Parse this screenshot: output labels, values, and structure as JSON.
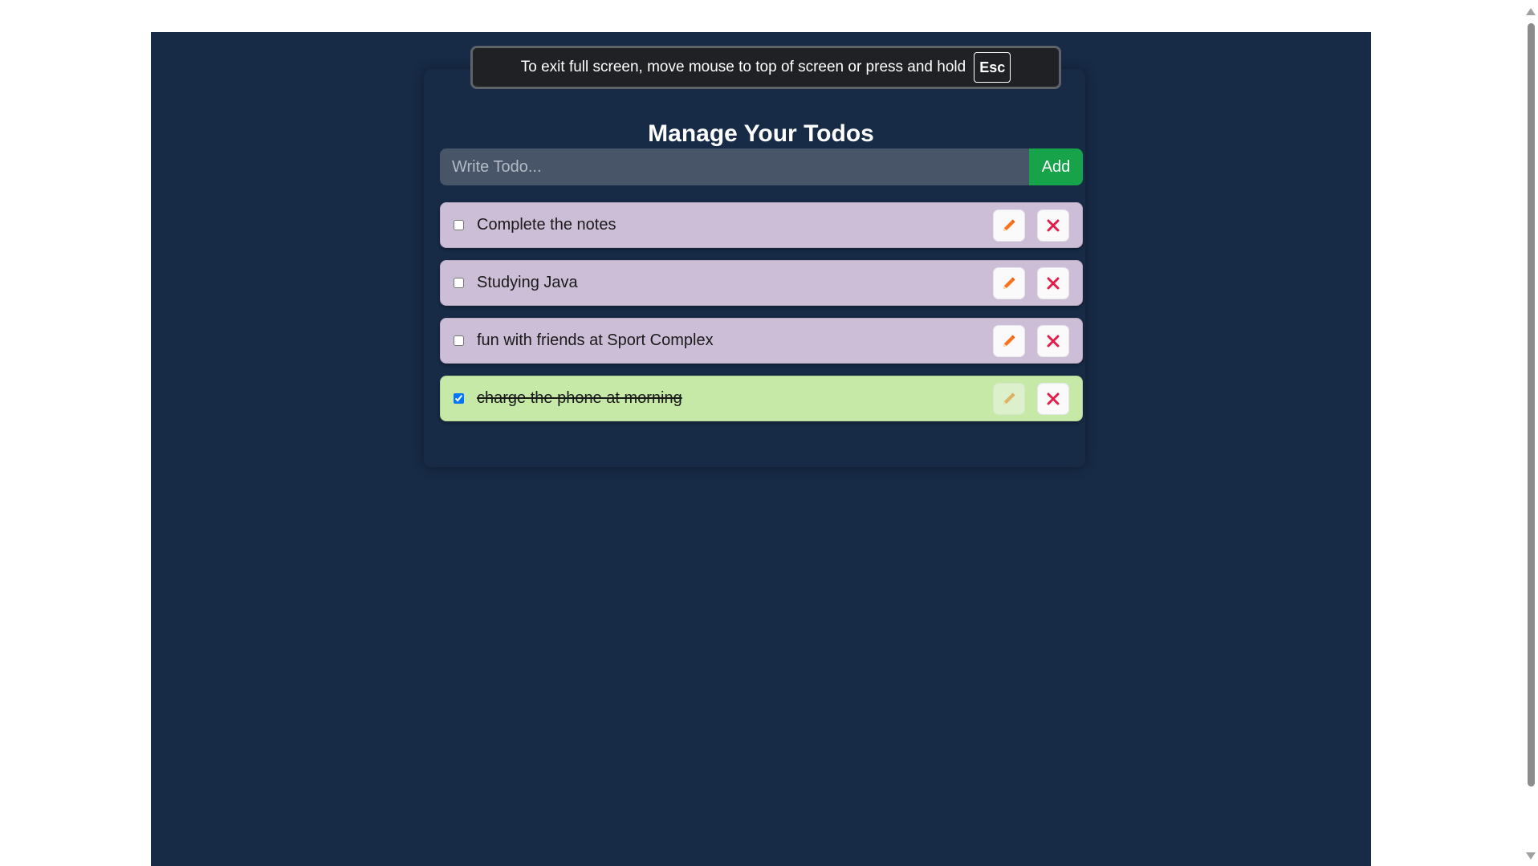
{
  "fullscreen_notice": {
    "message": "To exit full screen, move mouse to top of screen or press and hold",
    "key": "Esc"
  },
  "app": {
    "title": "Manage Your Todos",
    "input_placeholder": "Write Todo...",
    "input_value": "",
    "add_label": "Add"
  },
  "todos": [
    {
      "text": "Complete the notes",
      "completed": false
    },
    {
      "text": "Studying Java",
      "completed": false
    },
    {
      "text": "fun with friends at Sport Complex",
      "completed": false
    },
    {
      "text": "charge the phone at morning",
      "completed": true
    }
  ],
  "icons": {
    "edit": "pencil-icon",
    "delete": "close-icon"
  },
  "colors": {
    "background": "#172a46",
    "input_bg": "#485568",
    "add_button": "#16a34a",
    "pending_item": "#ccbed7",
    "completed_item": "#c6e9a7",
    "pencil": "#f97316",
    "delete": "#e11d48"
  }
}
